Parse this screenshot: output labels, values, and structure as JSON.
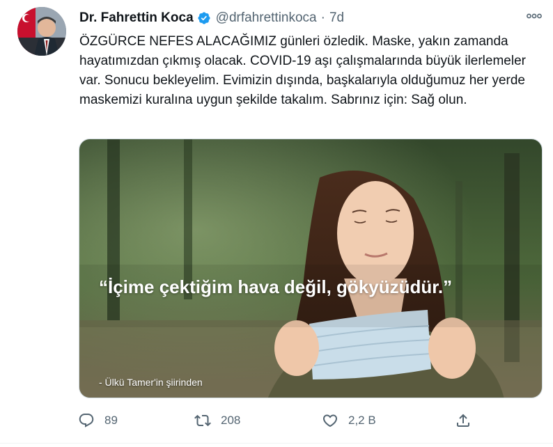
{
  "tweet": {
    "display_name": "Dr. Fahrettin Koca",
    "handle": "@drfahrettinkoca",
    "separator": "·",
    "time": "7d",
    "text": "ÖZGÜRCE NEFES ALACAĞIMIZ günleri özledik. Maske, yakın zamanda hayatımızdan çıkmış olacak. COVID-19 aşı çalışmalarında büyük ilerlemeler var. Sonucu bekleyelim. Evimizin dışında, başkalarıyla olduğumuz her yerde maskemizi kuralına uygun şekilde takalım. Sabrınız için: Sağ olun.",
    "image_quote": "“İçime çektiğim hava değil, gökyüzüdür.”",
    "image_credit": "- Ülkü Tamer'in şiirinden"
  },
  "actions": {
    "reply_count": "89",
    "retweet_count": "208",
    "like_count": "2,2 B"
  },
  "icons": {
    "verified": "verified-badge-icon",
    "more": "more-icon",
    "reply": "reply-icon",
    "retweet": "retweet-icon",
    "like": "heart-icon",
    "share": "share-icon"
  },
  "colors": {
    "verified_blue": "#1d9bf0",
    "text_secondary": "#536471"
  }
}
